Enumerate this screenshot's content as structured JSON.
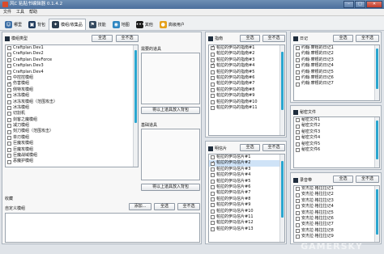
{
  "window": {
    "title": "风C 粘贴书编辑器 0.1.4.2"
  },
  "menu": [
    "文件",
    "工具",
    "帮助"
  ],
  "tabs": [
    "哪里",
    "背包",
    "模组/收集品",
    "技能",
    "地图",
    "其他",
    "高级用户"
  ],
  "left": {
    "header": "模组类型",
    "select_all": "全选",
    "deselect_all": "全不选",
    "items": [
      {
        "label": "Craftplan.Dev1",
        "checked": false
      },
      {
        "label": "Craftplan.Dev2",
        "checked": false
      },
      {
        "label": "Craftplan.DevForce",
        "checked": false
      },
      {
        "label": "Craftplan.Dev3",
        "checked": false
      },
      {
        "label": "Craftplan.Dev4",
        "checked": false
      },
      {
        "label": "中控控模组",
        "checked": false
      },
      {
        "label": "伤害模组",
        "checked": true
      },
      {
        "label": "侧特攻模组",
        "checked": false
      },
      {
        "label": "冰冻模组",
        "checked": false
      },
      {
        "label": "冰冻攻模组（范围攻击）",
        "checked": false
      },
      {
        "label": "冰冻模组",
        "checked": false
      },
      {
        "label": "切割机",
        "checked": false
      },
      {
        "label": "剑客之魔模组",
        "checked": false
      },
      {
        "label": "减刀模组",
        "checked": false
      },
      {
        "label": "刻刀模组（范围攻击）",
        "checked": false
      },
      {
        "label": "单刃模组",
        "checked": false
      },
      {
        "label": "巨魔攻模组",
        "checked": false
      },
      {
        "label": "巨魔攻模组",
        "checked": false
      },
      {
        "label": "巨魔战域模组",
        "checked": false
      },
      {
        "label": "恶魔护模组",
        "checked": false
      }
    ]
  },
  "needed": {
    "header": "需要的道具",
    "button": "将以上道具放入背包"
  },
  "base": {
    "header": "基础道具",
    "button": "将以上道具放入背包"
  },
  "inventory": {
    "label": "收藏"
  },
  "custom": {
    "label": "自定义模组",
    "add": "添加...",
    "select_all": "全选",
    "deselect_all": "全不选"
  },
  "guide": {
    "header": "指南",
    "select_all": "全选",
    "deselect_all": "全不选",
    "items": [
      {
        "label": "帕拉的伊马的指南#1",
        "checked": true
      },
      {
        "label": "帕拉的伊马的指南#2",
        "checked": false
      },
      {
        "label": "帕拉的伊马的指南#3",
        "checked": false
      },
      {
        "label": "帕拉的伊马的指南#4",
        "checked": true
      },
      {
        "label": "帕拉的伊马的指南#5",
        "checked": false
      },
      {
        "label": "帕拉的伊马的指南#6",
        "checked": false
      },
      {
        "label": "帕拉的伊马的指南#7",
        "checked": false
      },
      {
        "label": "帕拉的伊马的指南#8",
        "checked": false
      },
      {
        "label": "帕拉的伊马的指南#9",
        "checked": false
      },
      {
        "label": "帕拉的伊马的指南#10",
        "checked": false
      },
      {
        "label": "帕拉的伊马的指南#11",
        "checked": false
      }
    ]
  },
  "cards": {
    "header": "明信片",
    "select_all": "全选",
    "deselect_all": "全不选",
    "items": [
      {
        "label": "帕拉的伊马信片#1",
        "checked": false
      },
      {
        "label": "帕拉的伊马信片#2",
        "checked": true
      },
      {
        "label": "帕拉的伊马信片#3",
        "checked": false
      },
      {
        "label": "帕拉的伊马信片#4",
        "checked": false
      },
      {
        "label": "帕拉的伊马信片#5",
        "checked": false
      },
      {
        "label": "帕拉的伊马信片#6",
        "checked": false
      },
      {
        "label": "帕拉的伊马信片#7",
        "checked": false
      },
      {
        "label": "帕拉的伊马信片#8",
        "checked": false
      },
      {
        "label": "帕拉的伊马信片#9",
        "checked": false
      },
      {
        "label": "帕拉的伊马信片#10",
        "checked": false
      },
      {
        "label": "帕拉的伊马信片#11",
        "checked": false
      },
      {
        "label": "帕拉的伊马信片#12",
        "checked": false
      },
      {
        "label": "帕拉的伊马信片#13",
        "checked": false
      }
    ]
  },
  "diary": {
    "header": "日记",
    "select_all": "全选",
    "deselect_all": "全不选",
    "items": [
      {
        "label": "约翰·摩根的日记1",
        "checked": false
      },
      {
        "label": "约翰·摩根的日记2",
        "checked": false
      },
      {
        "label": "约翰·摩根的日记3",
        "checked": false
      },
      {
        "label": "约翰·摩根的日记4",
        "checked": false
      },
      {
        "label": "约翰·摩根的日记5",
        "checked": false
      },
      {
        "label": "约翰·摩根的日记6",
        "checked": false
      },
      {
        "label": "约翰·摩根的日记7",
        "checked": false
      }
    ]
  },
  "secret": {
    "header": "秘密文件",
    "select_all": "全选",
    "deselect_all": "全不选",
    "items": [
      {
        "label": "秘密文件1",
        "checked": false
      },
      {
        "label": "秘密文件2",
        "checked": false
      },
      {
        "label": "秘密文件3",
        "checked": false
      },
      {
        "label": "秘密文件4",
        "checked": false
      },
      {
        "label": "秘密文件5",
        "checked": false
      },
      {
        "label": "秘密文件6",
        "checked": false
      }
    ]
  },
  "tapes": {
    "header": "录音带",
    "select_all": "全选",
    "deselect_all": "全不选",
    "items": [
      {
        "label": "安杰拉·格拉拉记1",
        "checked": false
      },
      {
        "label": "安杰拉·格拉拉记2",
        "checked": false
      },
      {
        "label": "安杰拉·格拉拉记3",
        "checked": false
      },
      {
        "label": "安杰拉·格拉拉记4",
        "checked": false
      },
      {
        "label": "安杰拉·格拉拉记5",
        "checked": false
      },
      {
        "label": "安杰拉·格拉拉记6",
        "checked": false
      },
      {
        "label": "安杰拉·格拉拉记7",
        "checked": false
      },
      {
        "label": "安杰拉·格拉拉记8",
        "checked": false
      },
      {
        "label": "安杰拉·格拉拉记9",
        "checked": false
      }
    ]
  },
  "watermark": "GAMERSKY",
  "colors": {
    "accent": "#2aa6cf",
    "title_bar": "#4a6f9c",
    "selection": "#cfe3f7"
  }
}
